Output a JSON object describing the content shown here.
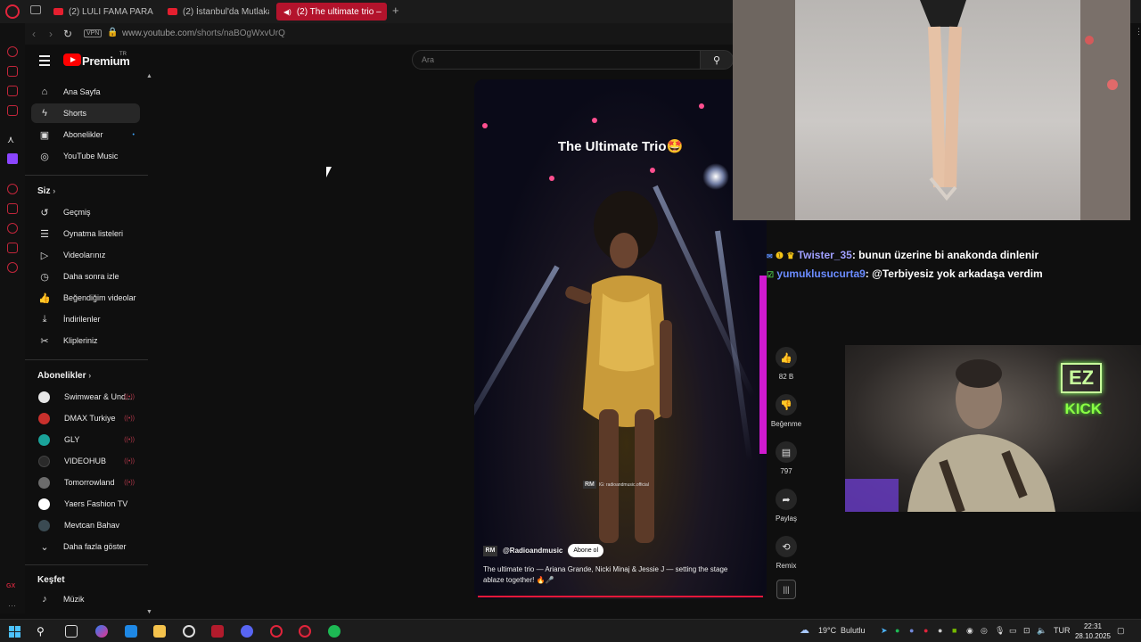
{
  "browser": {
    "tabs": [
      {
        "label": "(2) LULI FAMA PARAISO A"
      },
      {
        "label": "(2) İstanbul'da Mutlaka Y"
      },
      {
        "label": "(2) The ultimate trio –"
      }
    ],
    "new_tab": "+",
    "vpn": "VPN",
    "url_host": "www.youtube.com",
    "url_path": "/shorts/naBOgWxvUrQ"
  },
  "youtube": {
    "brand": "Premium",
    "region": "TR",
    "search_placeholder": "Ara",
    "nav_main": [
      {
        "label": "Ana Sayfa",
        "icon": "home-icon"
      },
      {
        "label": "Shorts",
        "icon": "shorts-icon"
      },
      {
        "label": "Abonelikler",
        "icon": "subscriptions-icon"
      },
      {
        "label": "YouTube Music",
        "icon": "music-icon"
      }
    ],
    "you_title": "Siz",
    "nav_you": [
      {
        "label": "Geçmiş",
        "icon": "history-icon"
      },
      {
        "label": "Oynatma listeleri",
        "icon": "playlists-icon"
      },
      {
        "label": "Videolarınız",
        "icon": "your-videos-icon"
      },
      {
        "label": "Daha sonra izle",
        "icon": "watch-later-icon"
      },
      {
        "label": "Beğendiğim videolar",
        "icon": "liked-icon"
      },
      {
        "label": "İndirilenler",
        "icon": "download-icon"
      },
      {
        "label": "Klipleriniz",
        "icon": "clips-icon"
      }
    ],
    "subs_title": "Abonelikler",
    "subscriptions": [
      {
        "name": "Swimwear & Und...",
        "color": "#e6e6e6"
      },
      {
        "name": "DMAX Turkiye",
        "color": "#c9302c"
      },
      {
        "name": "GLY",
        "color": "#1aa39a"
      },
      {
        "name": "VIDEOHUB",
        "color": "#2a2a2a"
      },
      {
        "name": "Tomorrowland",
        "color": "#6b6b6b"
      },
      {
        "name": "Yaers Fashion TV",
        "color": "#ffffff"
      },
      {
        "name": "Mevtcan Bahav",
        "color": "#3a4a52"
      }
    ],
    "show_more": "Daha fazla göster",
    "explore_title": "Keşfet",
    "explore_items": [
      {
        "label": "Müzik",
        "icon": "music-note-icon"
      }
    ]
  },
  "short": {
    "title": "The Ultimate Trio🤩",
    "watermark_logo": "RM",
    "watermark_text": "IG: radioandmusic.official",
    "channel_logo": "RM",
    "channel": "@Radioandmusic",
    "subscribe": "Abone ol",
    "description": "The ultimate trio — Ariana Grande, Nicki Minaj & Jessie J — setting the stage ablaze together! 🔥🎤",
    "progress": 1.0,
    "actions": [
      {
        "label": "82 B",
        "icon": "like-icon"
      },
      {
        "label": "Beğenme",
        "icon": "dislike-icon"
      },
      {
        "label": "797",
        "icon": "comment-icon"
      },
      {
        "label": "Paylaş",
        "icon": "share-icon"
      },
      {
        "label": "Remix",
        "icon": "remix-icon"
      }
    ]
  },
  "stream_chat": [
    {
      "user": "Twister_35",
      "message": ": bunun üzerine bi anakonda dinlenir"
    },
    {
      "user": "yumuklusucurta9",
      "message": ": @Terbiyesiz yok arkadaşa verdim"
    }
  ],
  "cam_overlay": {
    "badge": "EZ",
    "platform": "KICK"
  },
  "taskbar": {
    "weather_temp": "19°C",
    "weather_text": "Bulutlu",
    "lang": "TUR",
    "time": "22:31",
    "date": "28.10.2025"
  },
  "colors": {
    "accent": "#ff0000",
    "opera": "#e0243b",
    "kick_green": "#53fc18"
  }
}
